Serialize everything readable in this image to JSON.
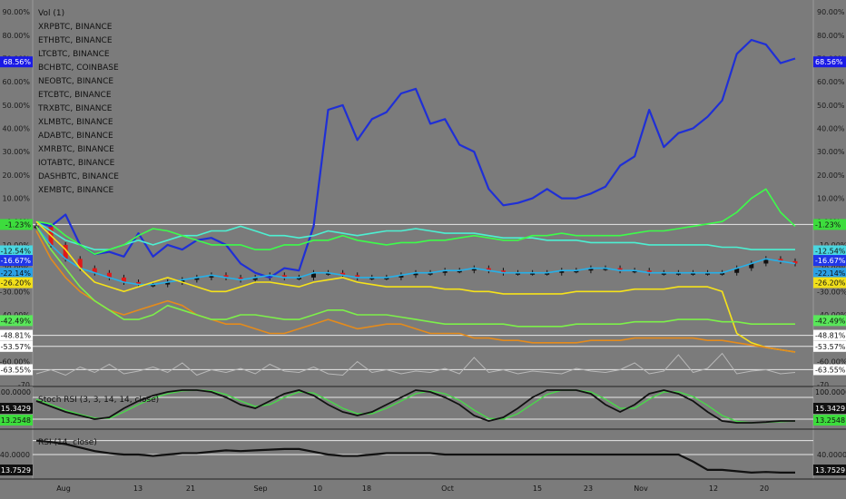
{
  "chart_data": {
    "type": "line",
    "legend_items": [
      "Vol (1)",
      "XRPBTC, BINANCE",
      "ETHBTC, BINANCE",
      "LTCBTC, BINANCE",
      "BCHBTC, COINBASE",
      "NEOBTC, BINANCE",
      "ETCBTC, BINANCE",
      "TRXBTC, BINANCE",
      "XLMBTC, BINANCE",
      "ADABTC, BINANCE",
      "XMRBTC, BINANCE",
      "IOTABTC, BINANCE",
      "DASHBTC, BINANCE",
      "XEMBTC, BINANCE"
    ],
    "x_ticks": [
      "Aug",
      "13",
      "21",
      "Sep",
      "10",
      "18",
      "Oct",
      "15",
      "23",
      "Nov",
      "12",
      "20"
    ],
    "y_ticks": [
      "90.00%",
      "80.00%",
      "70.00%",
      "60.00%",
      "50.00%",
      "40.00%",
      "30.00%",
      "20.00%",
      "10.00%",
      "0.00%",
      "-10.00%",
      "-20.00%",
      "-30.00%",
      "-40.00%",
      "-50.00%",
      "-60.00%",
      "-70"
    ],
    "ylim": [
      -70,
      92
    ],
    "series": [
      {
        "color": "#1f2fd6",
        "values": [
          0,
          -2,
          3,
          -10,
          -14,
          -13,
          -15,
          -5,
          -15,
          -10,
          -12,
          -8,
          -7,
          -10,
          -18,
          -22,
          -24,
          -20,
          -21,
          -2,
          48,
          50,
          35,
          44,
          47,
          55,
          57,
          42,
          44,
          33,
          30,
          14,
          7,
          8,
          10,
          14,
          10,
          10,
          12,
          15,
          24,
          28,
          48,
          32,
          38,
          40,
          45,
          52,
          72,
          78,
          76,
          68,
          70
        ]
      },
      {
        "color": "#27b0e8",
        "values": [
          -2,
          -10,
          -16,
          -20,
          -22,
          -24,
          -26,
          -27,
          -27,
          -26,
          -25,
          -24,
          -23,
          -24,
          -25,
          -24,
          -23,
          -24,
          -24,
          -22,
          -22,
          -23,
          -24,
          -24,
          -24,
          -23,
          -22,
          -22,
          -21,
          -21,
          -20,
          -21,
          -22,
          -22,
          -22,
          -22,
          -21,
          -21,
          -20,
          -20,
          -21,
          -21,
          -22,
          -22,
          -22,
          -22,
          -22,
          -22,
          -20,
          -18,
          -16,
          -17,
          -18
        ]
      },
      {
        "color": "#4df0d2",
        "values": [
          0,
          -4,
          -8,
          -10,
          -12,
          -12,
          -10,
          -8,
          -10,
          -8,
          -6,
          -6,
          -4,
          -4,
          -2,
          -4,
          -6,
          -6,
          -7,
          -6,
          -4,
          -5,
          -6,
          -5,
          -4,
          -4,
          -3,
          -4,
          -5,
          -5,
          -5,
          -6,
          -7,
          -7,
          -7,
          -8,
          -8,
          -8,
          -9,
          -9,
          -9,
          -9,
          -10,
          -10,
          -10,
          -10,
          -10,
          -11,
          -11,
          -12,
          -12,
          -12,
          -12
        ]
      },
      {
        "color": "#3dfc4a",
        "values": [
          0,
          -1,
          -6,
          -10,
          -14,
          -12,
          -10,
          -6,
          -3,
          -4,
          -6,
          -8,
          -10,
          -10,
          -10,
          -12,
          -12,
          -10,
          -10,
          -8,
          -8,
          -6,
          -8,
          -9,
          -10,
          -9,
          -9,
          -8,
          -8,
          -7,
          -6,
          -7,
          -8,
          -8,
          -6,
          -6,
          -5,
          -6,
          -6,
          -6,
          -6,
          -5,
          -4,
          -4,
          -3,
          -2,
          -1,
          0,
          4,
          10,
          14,
          4,
          -2
        ]
      },
      {
        "color": "#f6e21a",
        "values": [
          0,
          -6,
          -12,
          -20,
          -26,
          -28,
          -30,
          -28,
          -26,
          -24,
          -26,
          -28,
          -30,
          -30,
          -28,
          -26,
          -26,
          -27,
          -28,
          -26,
          -25,
          -24,
          -26,
          -27,
          -28,
          -28,
          -28,
          -28,
          -29,
          -29,
          -30,
          -30,
          -31,
          -31,
          -31,
          -31,
          -31,
          -30,
          -30,
          -30,
          -30,
          -29,
          -29,
          -29,
          -28,
          -28,
          -28,
          -30,
          -48,
          -52,
          -54,
          -55,
          -56
        ]
      },
      {
        "color": "#e48b1c",
        "values": [
          -4,
          -16,
          -24,
          -30,
          -34,
          -38,
          -40,
          -38,
          -36,
          -34,
          -36,
          -40,
          -42,
          -44,
          -44,
          -46,
          -48,
          -48,
          -46,
          -44,
          -42,
          -44,
          -46,
          -45,
          -44,
          -44,
          -46,
          -48,
          -48,
          -48,
          -50,
          -50,
          -51,
          -51,
          -52,
          -52,
          -52,
          -52,
          -51,
          -51,
          -51,
          -50,
          -50,
          -50,
          -50,
          -50,
          -51,
          -51,
          -52,
          -53,
          -54,
          -55,
          -56
        ]
      },
      {
        "color": "#7cf04a",
        "values": [
          -2,
          -12,
          -20,
          -28,
          -34,
          -38,
          -42,
          -42,
          -40,
          -36,
          -38,
          -40,
          -42,
          -42,
          -40,
          -40,
          -41,
          -42,
          -42,
          -40,
          -38,
          -38,
          -40,
          -40,
          -40,
          -41,
          -42,
          -43,
          -44,
          -44,
          -44,
          -44,
          -44,
          -45,
          -45,
          -45,
          -45,
          -44,
          -44,
          -44,
          -44,
          -43,
          -43,
          -43,
          -42,
          -42,
          -42,
          -43,
          -43,
          -44,
          -44,
          -44,
          -44
        ]
      }
    ],
    "ohlc_series": "BTC-relative candles (red/black)",
    "price_badges": [
      {
        "text": "68.56%",
        "bg": "#1a1ae6",
        "fg": "#ffffff",
        "value": 68.56
      },
      {
        "text": "-1.23%",
        "bg": "#3ddc3d",
        "fg": "#111111",
        "value": -1.23
      },
      {
        "text": "-12.54%",
        "bg": "#4ad6e0",
        "fg": "#111111",
        "value": -12.54
      },
      {
        "text": "-16.67%",
        "bg": "#2036e8",
        "fg": "#ffffff",
        "value": -16.67
      },
      {
        "text": "-22.14%",
        "bg": "#2aa0e6",
        "fg": "#111111",
        "value": -22.14
      },
      {
        "text": "-26.20%",
        "bg": "#f2e01a",
        "fg": "#111111",
        "value": -26.2
      },
      {
        "text": "-42.49%",
        "bg": "#59e85a",
        "fg": "#111111",
        "value": -42.49
      },
      {
        "text": "-48.81%",
        "bg": "#ffffff",
        "fg": "#111111",
        "value": -48.81
      },
      {
        "text": "-53.57%",
        "bg": "#ffffff",
        "fg": "#111111",
        "value": -53.57
      },
      {
        "text": "-63.55%",
        "bg": "#ffffff",
        "fg": "#111111",
        "value": -63.55
      }
    ],
    "stoch": {
      "title": "Stoch RSI (3, 3, 14, 14, close)",
      "labels_left": [
        "100.0000",
        "15.3429",
        "13.2548"
      ],
      "labels_right": [
        "100.0000",
        "15.3429",
        "13.2548"
      ],
      "k": [
        70,
        55,
        40,
        30,
        20,
        25,
        50,
        70,
        85,
        95,
        100,
        100,
        95,
        80,
        60,
        50,
        70,
        90,
        100,
        85,
        60,
        40,
        30,
        40,
        60,
        80,
        100,
        95,
        80,
        60,
        30,
        15,
        25,
        50,
        80,
        100,
        100,
        100,
        90,
        60,
        40,
        60,
        90,
        100,
        90,
        70,
        40,
        15,
        10,
        10,
        12,
        15,
        15
      ],
      "d": [
        75,
        60,
        45,
        33,
        23,
        22,
        40,
        60,
        78,
        90,
        98,
        100,
        98,
        88,
        70,
        55,
        60,
        80,
        95,
        92,
        72,
        50,
        35,
        35,
        50,
        70,
        90,
        98,
        90,
        72,
        45,
        22,
        20,
        35,
        62,
        88,
        100,
        100,
        95,
        75,
        50,
        50,
        75,
        95,
        95,
        82,
        58,
        30,
        14,
        10,
        11,
        13,
        15
      ]
    },
    "rsi": {
      "title": "RSI (14, close)",
      "label_left": "13.7529",
      "label_right": "13.7529",
      "tick": "40.0000",
      "values": [
        60,
        58,
        55,
        50,
        45,
        42,
        40,
        40,
        38,
        40,
        42,
        42,
        44,
        46,
        45,
        46,
        47,
        48,
        48,
        44,
        40,
        38,
        38,
        40,
        42,
        42,
        42,
        42,
        40,
        40,
        40,
        40,
        40,
        40,
        40,
        40,
        40,
        40,
        40,
        40,
        40,
        40,
        40,
        40,
        40,
        30,
        18,
        18,
        16,
        14,
        15,
        14,
        14
      ]
    },
    "volume": {
      "values": [
        20,
        35,
        15,
        45,
        25,
        55,
        20,
        30,
        45,
        25,
        60,
        15,
        35,
        25,
        40,
        20,
        55,
        30,
        25,
        45,
        20,
        15,
        65,
        25,
        35,
        20,
        30,
        25,
        40,
        20,
        80,
        25,
        35,
        20,
        30,
        25,
        20,
        40,
        30,
        25,
        35,
        60,
        20,
        30,
        90,
        25,
        40,
        95,
        20,
        30,
        35,
        20,
        25
      ]
    }
  }
}
